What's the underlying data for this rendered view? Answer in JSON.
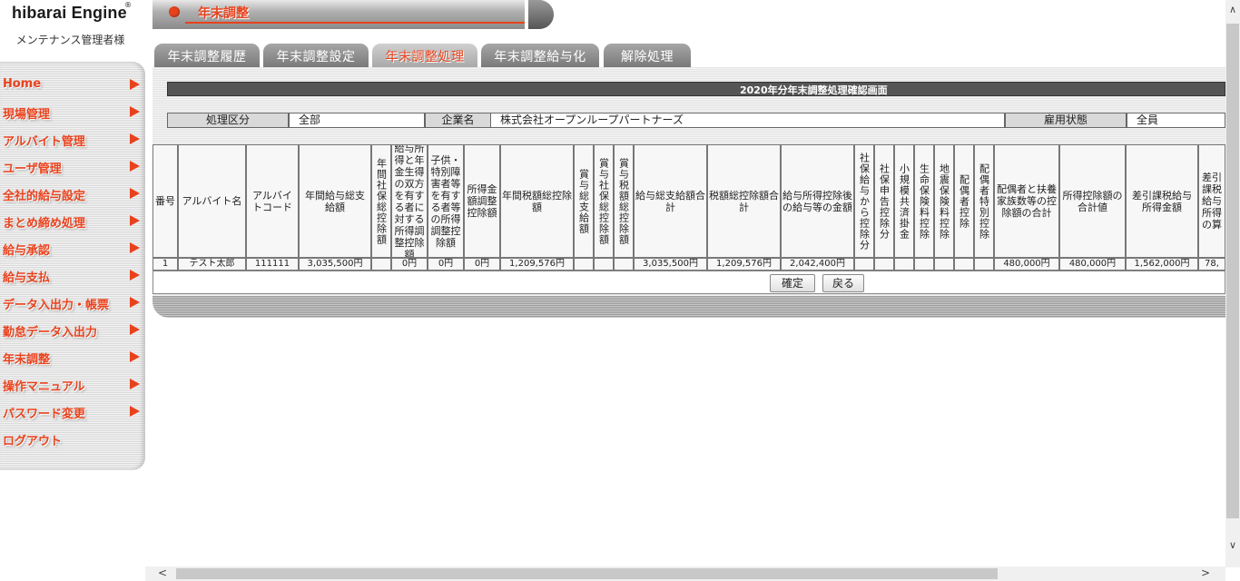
{
  "logo": {
    "text": "hibarai Engine",
    "reg": "®"
  },
  "user_label": "メンテナンス管理者様",
  "sidebar": {
    "items": [
      {
        "label": "Home",
        "arrow": true
      },
      {
        "label": "現場管理",
        "arrow": true
      },
      {
        "label": "アルバイト管理",
        "arrow": true
      },
      {
        "label": "ユーザ管理",
        "arrow": true
      },
      {
        "label": "全社的給与設定",
        "arrow": true
      },
      {
        "label": "まとめ締め処理",
        "arrow": true
      },
      {
        "label": "給与承認",
        "arrow": true
      },
      {
        "label": "給与支払",
        "arrow": true
      },
      {
        "label": "データ入出力・帳票",
        "arrow": true
      },
      {
        "label": "勤怠データ入出力",
        "arrow": true
      },
      {
        "label": "年末調整",
        "arrow": true
      },
      {
        "label": "操作マニュアル",
        "arrow": true
      },
      {
        "label": "パスワード変更",
        "arrow": true
      },
      {
        "label": "ログアウト",
        "arrow": false
      }
    ]
  },
  "header": {
    "title": "年末調整"
  },
  "tabs": [
    {
      "label": "年末調整履歴",
      "active": false
    },
    {
      "label": "年末調整設定",
      "active": false
    },
    {
      "label": "年末調整処理",
      "active": true
    },
    {
      "label": "年末調整給与化",
      "active": false
    },
    {
      "label": "解除処理",
      "active": false
    }
  ],
  "panel": {
    "title": "2020年分年末調整処理確認画面",
    "filters": {
      "kbn_label": "処理区分",
      "kbn_value": "全部",
      "company_label": "企業名",
      "company_value": "株式会社オープンループパートナーズ",
      "status_label": "雇用状態",
      "status_value": "全員"
    }
  },
  "table": {
    "headers": [
      "番号",
      "アルバイト名",
      "アルバイトコード",
      "年間給与総支給額",
      "年間社保総控除額",
      "給与所得と年金生得の双方を有する者に対する所得調整控除額",
      "子供・特別障害者等を有する者等の所得調整控除額",
      "所得金額調整控除額",
      "年間税額総控除額",
      "賞与総支給額",
      "賞与社保総控除額",
      "賞与税額総控除額",
      "給与総支給額合計",
      "税額総控除額合計",
      "給与所得控除後の給与等の金額",
      "社保給与から控除分",
      "社保申告控除分",
      "小規模共済掛金",
      "生命保険料控除",
      "地震保険料控除",
      "配偶者控除",
      "配偶者特別控除",
      "配偶者と扶養家族数等の控除額の合計",
      "所得控除額の合計値",
      "差引課税給与所得金額",
      "差引課税給与所得の算"
    ],
    "rows": [
      [
        "1",
        "テスト太郎",
        "111111",
        "3,035,500円",
        "",
        "0円",
        "0円",
        "0円",
        "1,209,576円",
        "",
        "",
        "",
        "3,035,500円",
        "1,209,576円",
        "2,042,400円",
        "",
        "",
        "",
        "",
        "",
        "",
        "",
        "480,000円",
        "480,000円",
        "1,562,000円",
        "78,"
      ]
    ],
    "buttons": {
      "confirm": "確定",
      "back": "戻る"
    }
  },
  "scroll": {
    "up": "∧",
    "down": "∨",
    "left": "<",
    "right": ">"
  }
}
